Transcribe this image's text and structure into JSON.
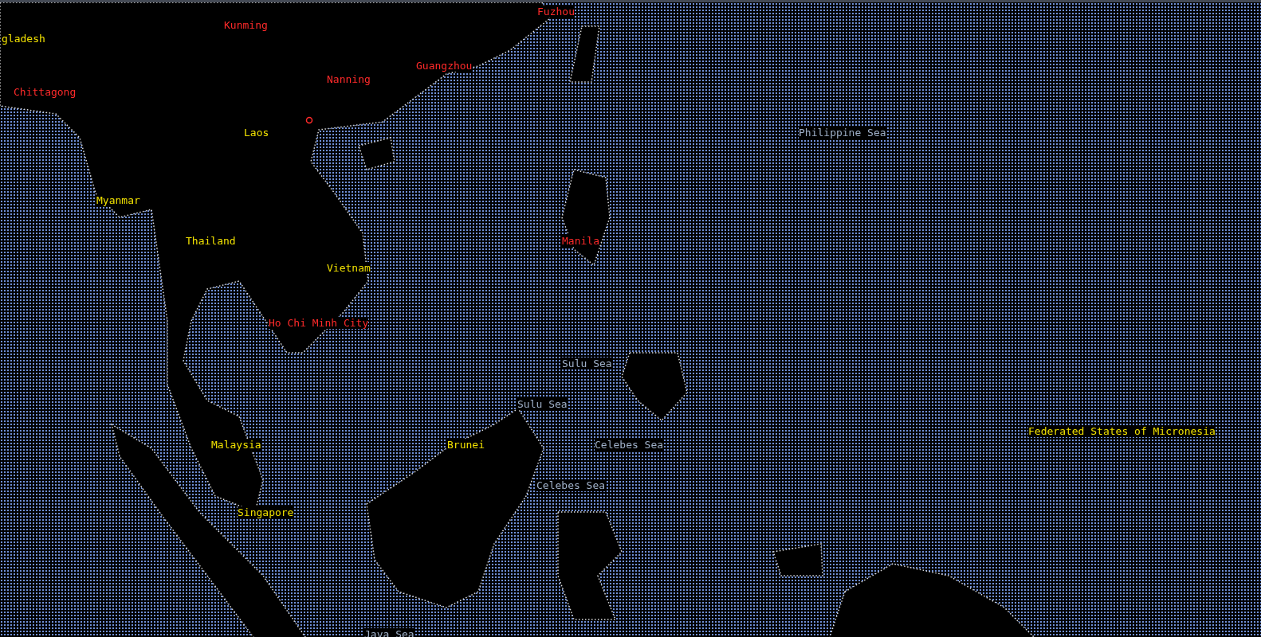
{
  "map": {
    "labels": [
      {
        "text": "Fuzhou",
        "kind": "city"
      },
      {
        "text": "Kunming",
        "kind": "city"
      },
      {
        "text": "gladesh",
        "kind": "country"
      },
      {
        "text": "Guangzhou",
        "kind": "city"
      },
      {
        "text": "Nanning",
        "kind": "city"
      },
      {
        "text": "Chittagong",
        "kind": "city"
      },
      {
        "text": "Laos",
        "kind": "country"
      },
      {
        "text": "Philippine Sea",
        "kind": "sea"
      },
      {
        "text": "Myanmar",
        "kind": "country"
      },
      {
        "text": "Thailand",
        "kind": "country"
      },
      {
        "text": "Manila",
        "kind": "city"
      },
      {
        "text": "Vietnam",
        "kind": "country"
      },
      {
        "text": "Ho Chi Minh City",
        "kind": "city"
      },
      {
        "text": "Sulu Sea",
        "kind": "sea"
      },
      {
        "text": "Sulu Sea",
        "kind": "sea"
      },
      {
        "text": "Federated States of Micronesia",
        "kind": "country"
      },
      {
        "text": "Malaysia",
        "kind": "country"
      },
      {
        "text": "Brunei",
        "kind": "country"
      },
      {
        "text": "Celebes Sea",
        "kind": "sea"
      },
      {
        "text": "Celebes Sea",
        "kind": "sea"
      },
      {
        "text": "Singapore",
        "kind": "country"
      },
      {
        "text": "Java Sea",
        "kind": "sea"
      }
    ]
  }
}
